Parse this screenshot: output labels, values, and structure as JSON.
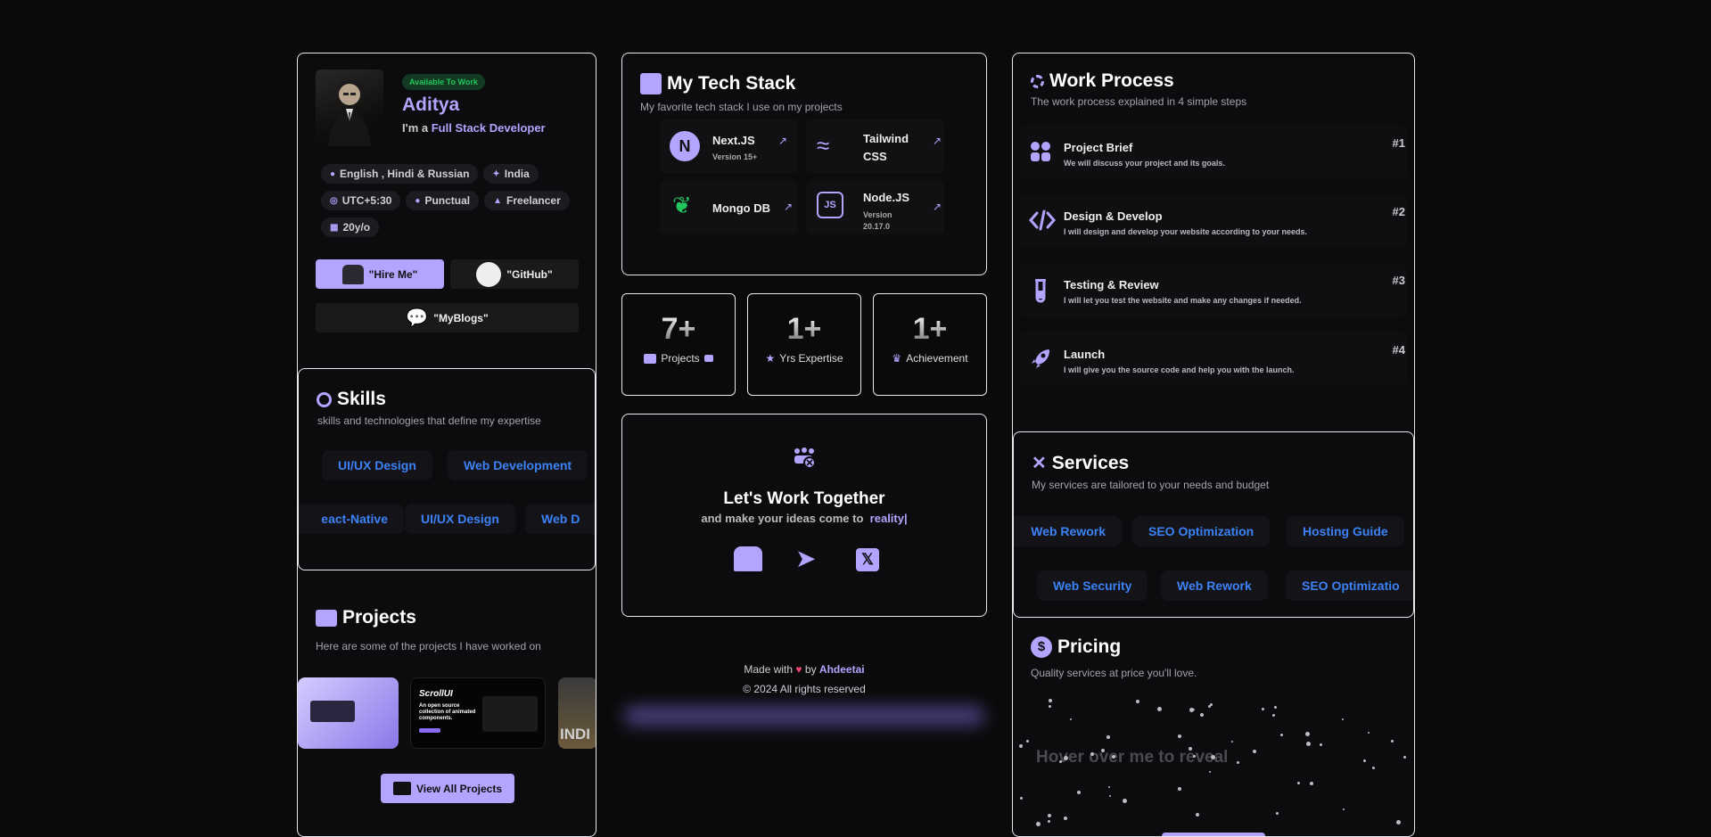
{
  "profile": {
    "badge": "Available To Work",
    "name": "Aditya",
    "tagline_prefix": "I'm a",
    "tagline_role": "Full Stack Developer",
    "chips": [
      {
        "icon": "microphone-icon",
        "label": "English , Hindi & Russian"
      },
      {
        "icon": "pin-icon",
        "label": "India"
      },
      {
        "icon": "globe-icon",
        "label": "UTC+5:30"
      },
      {
        "icon": "user-icon",
        "label": "Punctual"
      },
      {
        "icon": "building-icon",
        "label": "Freelancer"
      },
      {
        "icon": "calendar-icon",
        "label": "20y/o"
      }
    ],
    "hire_label": "\"Hire Me\"",
    "github_label": "\"GitHub\"",
    "blogs_label": "\"MyBlogs\""
  },
  "skills": {
    "title": "Skills",
    "subtitle": "skills and technologies that define my expertise",
    "row1": [
      "UI/UX Design",
      "Web Development"
    ],
    "row2": [
      "eact-Native",
      "UI/UX Design",
      "Web D"
    ]
  },
  "projects": {
    "title": "Projects",
    "subtitle": "Here are some of the projects I have worked on",
    "thumb2_title": "ScrollUI",
    "thumb2_text": "An open source collection of animated components.",
    "thumb3_text": "INDI",
    "view_all": "View All Projects"
  },
  "tech": {
    "title": "My Tech Stack",
    "subtitle": "My favorite tech stack I use on my projects",
    "items": [
      {
        "name": "Next.JS",
        "version": "Version 15+",
        "icon": "nextjs-icon"
      },
      {
        "name": "Tailwind CSS",
        "version": "",
        "icon": "tailwind-icon"
      },
      {
        "name": "Mongo DB",
        "version": "",
        "icon": "mongodb-icon"
      },
      {
        "name": "Node.JS",
        "version": "Version 20.17.0",
        "icon": "nodejs-icon"
      }
    ]
  },
  "stats": [
    {
      "num": "7+",
      "label": "Projects",
      "icon": "briefcase-icon"
    },
    {
      "num": "1+",
      "label": "Yrs Expertise",
      "icon": "star-icon"
    },
    {
      "num": "1+",
      "label": "Achievement",
      "icon": "trophy-icon"
    }
  ],
  "contact": {
    "title": "Let's Work Together",
    "sub_prefix": "and make your ideas come to",
    "sub_word": "reality|"
  },
  "footer": {
    "made_prefix": "Made with",
    "made_by": "by",
    "author": "Ahdeetai",
    "copyright": "© 2024 All rights reserved"
  },
  "process": {
    "title": "Work Process",
    "subtitle": "The work process explained in 4 simple steps",
    "steps": [
      {
        "title": "Project Brief",
        "desc": "We will discuss your project and its goals.",
        "num": "#1",
        "icon": "people-icon"
      },
      {
        "title": "Design & Develop",
        "desc": "I will design and develop your website according to your needs.",
        "num": "#2",
        "icon": "code-icon"
      },
      {
        "title": "Testing & Review",
        "desc": "I will let you test the website and make any changes if needed.",
        "num": "#3",
        "icon": "test-tube-icon"
      },
      {
        "title": "Launch",
        "desc": "I will give you the source code and help you with the launch.",
        "num": "#4",
        "icon": "rocket-icon"
      }
    ]
  },
  "services": {
    "title": "Services",
    "subtitle": "My services are tailored to your needs and budget",
    "row1": [
      "Web Rework",
      "SEO Optimization",
      "Hosting Guide"
    ],
    "row2": [
      "Web Security",
      "Web Rework",
      "SEO Optimizatio"
    ]
  },
  "pricing": {
    "title": "Pricing",
    "subtitle": "Quality services at price you'll love.",
    "reveal": "Hover over me to reveal"
  },
  "colors": {
    "accent": "#b4a3ff",
    "blue": "#3b82f6",
    "green": "#22c55e"
  }
}
